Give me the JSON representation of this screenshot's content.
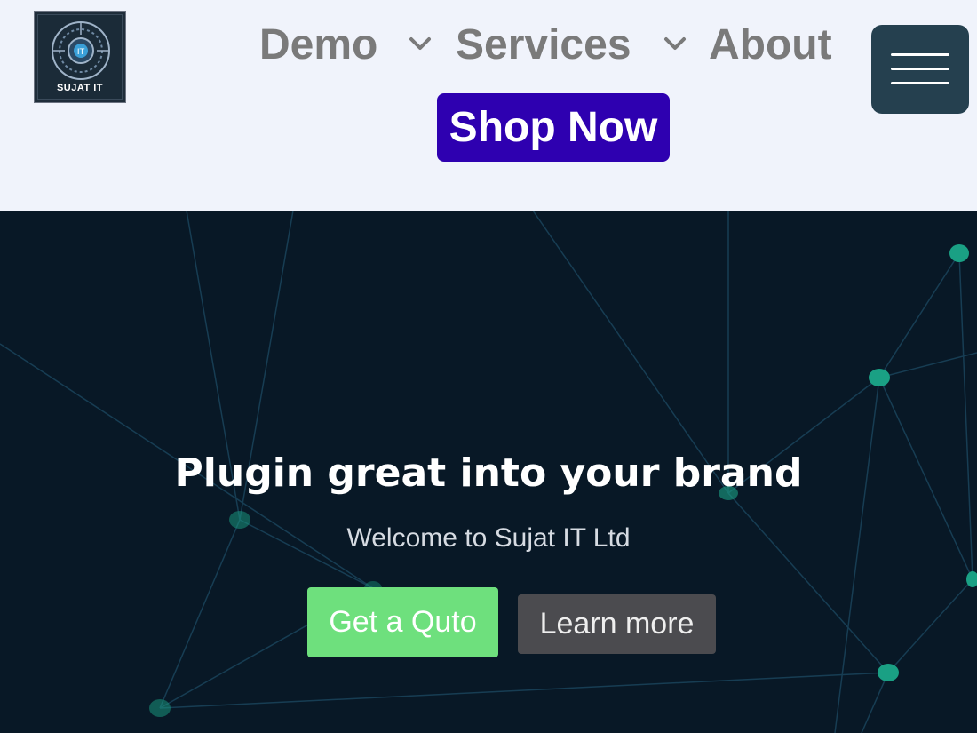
{
  "logo": {
    "text": "SUJAT IT"
  },
  "nav": {
    "items": [
      {
        "label": "Demo"
      },
      {
        "label": "Services"
      },
      {
        "label": "About"
      }
    ]
  },
  "cta": {
    "shop_label": "Shop Now"
  },
  "hero": {
    "title": "Plugin great into your brand",
    "subtitle": "Welcome to Sujat IT Ltd",
    "quote_label": "Get a Quto",
    "learn_label": "Learn more"
  },
  "colors": {
    "page_bg": "#f0f3fb",
    "shop_button": "#2e00b0",
    "menu_button": "#25404f",
    "hero_bg": "#081826",
    "quote_button": "#6ee07d",
    "learn_button": "#4b4b4f",
    "network_node": "#1aa084"
  }
}
